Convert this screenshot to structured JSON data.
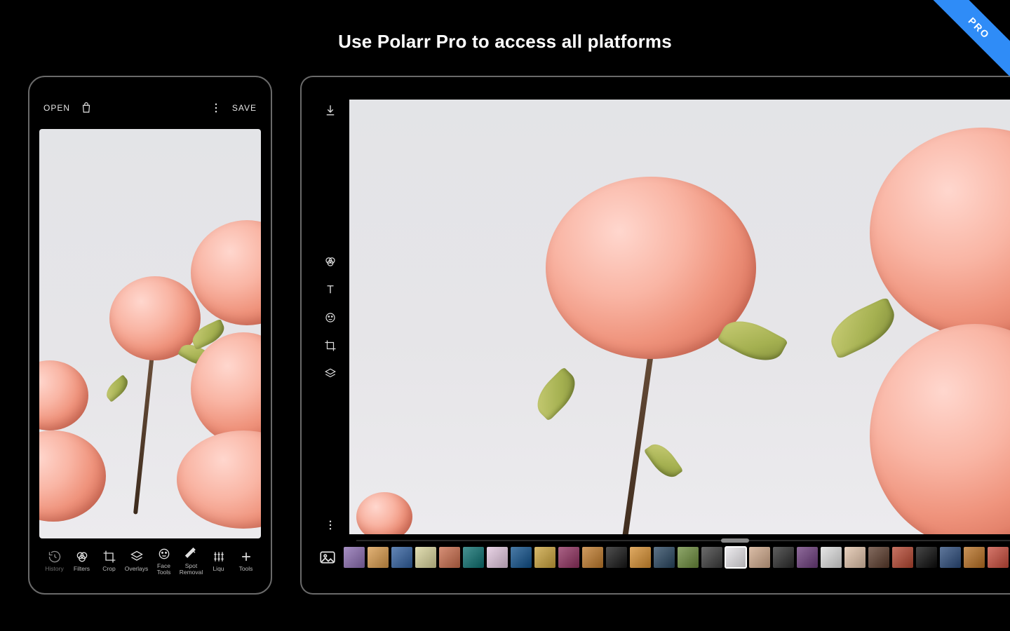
{
  "headline": "Use Polarr Pro to access all platforms",
  "ribbon": "PRO",
  "phone": {
    "open_label": "OPEN",
    "save_label": "SAVE",
    "tools": [
      {
        "icon": "history-icon",
        "label": "History"
      },
      {
        "icon": "filters-icon",
        "label": "Filters"
      },
      {
        "icon": "crop-icon",
        "label": "Crop"
      },
      {
        "icon": "overlays-icon",
        "label": "Overlays"
      },
      {
        "icon": "face-tools-icon",
        "label": "Face\nTools"
      },
      {
        "icon": "spot-removal-icon",
        "label": "Spot\nRemoval"
      },
      {
        "icon": "liquify-icon",
        "label": "Liqu"
      },
      {
        "icon": "tools-icon",
        "label": "Tools"
      }
    ]
  },
  "tablet": {
    "left_tools": [
      {
        "icon": "filters-icon"
      },
      {
        "icon": "text-icon"
      },
      {
        "icon": "face-tools-icon"
      },
      {
        "icon": "crop-icon"
      },
      {
        "icon": "overlays-icon"
      }
    ],
    "filmstrip_selected_index": 16,
    "filmstrip": [
      "#8a6bb0",
      "#d99a4a",
      "#2f5e9e",
      "#d8d39a",
      "#c96b4a",
      "#0a6e6e",
      "#e2c6de",
      "#0e4f8a",
      "#caa23a",
      "#8f2f5e",
      "#c07a2a",
      "#151515",
      "#d68e2f",
      "#27445e",
      "#6a8a3a",
      "#3a3a3a",
      "#e8e6ea",
      "#cfa88a",
      "#2a2a2a",
      "#6a3a7a",
      "#dedede",
      "#e0c1a8",
      "#5a3a2a",
      "#b5452f",
      "#0a0a0a",
      "#2a4a7a",
      "#b86f21",
      "#c84a3a",
      "#3a6aa0",
      "#111111",
      "#2a6a8a",
      "#caa23a",
      "#8f2f5e"
    ]
  }
}
